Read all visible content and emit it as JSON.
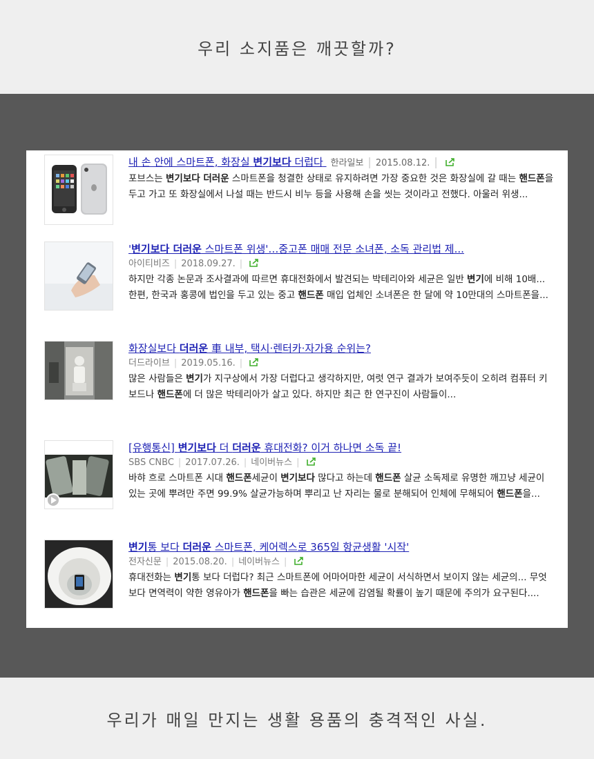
{
  "top_caption": "우리 소지품은 깨끗할까?",
  "bottom_caption": "우리가 매일 만지는 생활 용품의 충격적인 사실.",
  "accent": "#1e22b4",
  "share_icon_color": "#3fae2a",
  "results": [
    {
      "thumb": "iphone-image",
      "title_parts": [
        {
          "t": "내 손 안에 스마트폰, 화장실 ",
          "b": false
        },
        {
          "t": "변기보다",
          "b": true
        },
        {
          "t": " 더럽다",
          "b": false
        }
      ],
      "source": "한라일보",
      "date": "2015.08.12.",
      "portal": "",
      "snippet_parts": [
        {
          "t": "포브스는 ",
          "b": false
        },
        {
          "t": "변기보다 더러운",
          "b": true
        },
        {
          "t": " 스마트폰을 청결한 상태로 유지하려면 가장 중요한 것은 화장실에 갈 때는 ",
          "b": false
        },
        {
          "t": "핸드폰",
          "b": true
        },
        {
          "t": "을 두고 가고 또 화장실에서 나설 때는 반드시 비누 등을 사용해 손을 씻는 것이라고 전했다. 아울러 위생...",
          "b": false
        }
      ]
    },
    {
      "thumb": "hand-phone-image",
      "title_parts": [
        {
          "t": "'",
          "b": false
        },
        {
          "t": "변기보다 더러운",
          "b": true
        },
        {
          "t": " 스마트폰 위생'…중고폰 매매 전문 소녀폰, 소독 관리법 제...",
          "b": false
        }
      ],
      "source": "아이티비즈",
      "date": "2018.09.27.",
      "portal": "",
      "snippet_parts": [
        {
          "t": "하지만 각종 논문과 조사결과에 따르면 휴대전화에서 발견되는 박테리아와 세균은 일반 ",
          "b": false
        },
        {
          "t": "변기",
          "b": true
        },
        {
          "t": "에 비해 10배... 한편, 한국과 홍콩에 법인을 두고 있는 중고 ",
          "b": false
        },
        {
          "t": "핸드폰",
          "b": true
        },
        {
          "t": " 매입 업체인 소녀폰은 한 달에 약 10만대의 스마트폰을...",
          "b": false
        }
      ]
    },
    {
      "thumb": "car-toilet-image",
      "title_parts": [
        {
          "t": "화장실보다 ",
          "b": false
        },
        {
          "t": "더러운",
          "b": true
        },
        {
          "t": " 車 내부, 택시·렌터카·자가용 순위는?",
          "b": false
        }
      ],
      "source": "더드라이브",
      "date": "2019.05.16.",
      "portal": "",
      "snippet_parts": [
        {
          "t": "많은 사람들은 ",
          "b": false
        },
        {
          "t": "변기",
          "b": true
        },
        {
          "t": "가 지구상에서 가장 더럽다고 생각하지만, 여럿 연구 결과가 보여주듯이 오히려 컴퓨터 키보드나 ",
          "b": false
        },
        {
          "t": "핸드폰",
          "b": true
        },
        {
          "t": "에 더 많은 박테리아가 살고 있다. 하지만 최근 한 연구진이 사람들이...",
          "b": false
        }
      ]
    },
    {
      "thumb": "video-phones-image",
      "title_parts": [
        {
          "t": "[유행통신] ",
          "b": false
        },
        {
          "t": "변기보다",
          "b": true
        },
        {
          "t": " 더 ",
          "b": false
        },
        {
          "t": "더러운",
          "b": true
        },
        {
          "t": " 휴대전화? 이거 하나면 소독 끝!",
          "b": false
        }
      ],
      "source": "SBS CNBC",
      "date": "2017.07.26.",
      "portal": "네이버뉴스",
      "snippet_parts": [
        {
          "t": "바햐 흐로 스마트폰 시대 ",
          "b": false
        },
        {
          "t": "핸드폰",
          "b": true
        },
        {
          "t": "세균이 ",
          "b": false
        },
        {
          "t": "변기보다",
          "b": true
        },
        {
          "t": " 많다고 하는데 ",
          "b": false
        },
        {
          "t": "핸드폰",
          "b": true
        },
        {
          "t": " 살균 소독제로 유명한 깨끄냥 세균이 있는 곳에 뿌려만 주면 99.9% 살균가능하며 뿌리고 난 자리는 물로 분해되어 인체에 무해되어 ",
          "b": false
        },
        {
          "t": "핸드폰",
          "b": true
        },
        {
          "t": "을...",
          "b": false
        }
      ]
    },
    {
      "thumb": "toilet-phone-image",
      "title_parts": [
        {
          "t": "변기",
          "b": true
        },
        {
          "t": "통 보다 ",
          "b": false
        },
        {
          "t": "더러운",
          "b": true
        },
        {
          "t": " 스마트폰, 케어렉스로 365일 항균생활 '시작'",
          "b": false
        }
      ],
      "source": "전자신문",
      "date": "2015.08.20.",
      "portal": "네이버뉴스",
      "snippet_parts": [
        {
          "t": "휴대전화는 ",
          "b": false
        },
        {
          "t": "변기",
          "b": true
        },
        {
          "t": "통 보다 더럽다? 최근 스마트폰에 어마어마한 세균이 서식하면서 보이지 않는 세균의... 무엇보다 면역력이 약한 영유아가 ",
          "b": false
        },
        {
          "t": "핸드폰",
          "b": true
        },
        {
          "t": "을 빠는 습관은 세균에 감염될 확률이 높기 때문에 주의가 요구된다....",
          "b": false
        }
      ]
    }
  ]
}
